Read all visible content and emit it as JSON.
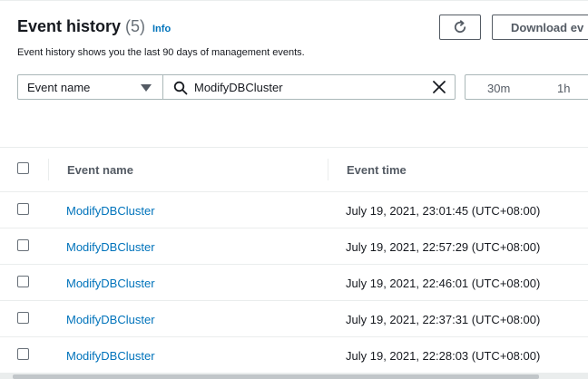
{
  "header": {
    "title": "Event history",
    "count": "(5)",
    "info_label": "Info",
    "subtitle": "Event history shows you the last 90 days of management events.",
    "download_label": "Download ev"
  },
  "filter": {
    "attribute_label": "Event name",
    "search_value": "ModifyDBCluster",
    "ranges": [
      "30m",
      "1h"
    ]
  },
  "table": {
    "columns": [
      "Event name",
      "Event time"
    ],
    "rows": [
      {
        "name": "ModifyDBCluster",
        "time": "July 19, 2021, 23:01:45 (UTC+08:00)"
      },
      {
        "name": "ModifyDBCluster",
        "time": "July 19, 2021, 22:57:29 (UTC+08:00)"
      },
      {
        "name": "ModifyDBCluster",
        "time": "July 19, 2021, 22:46:01 (UTC+08:00)"
      },
      {
        "name": "ModifyDBCluster",
        "time": "July 19, 2021, 22:37:31 (UTC+08:00)"
      },
      {
        "name": "ModifyDBCluster",
        "time": "July 19, 2021, 22:28:03 (UTC+08:00)"
      }
    ]
  },
  "colors": {
    "link": "#0073bb",
    "text": "#16191f",
    "muted": "#545b64",
    "border": "#aab7b8"
  },
  "icons": [
    "refresh-icon",
    "search-icon",
    "clear-icon",
    "caret-down-icon"
  ]
}
